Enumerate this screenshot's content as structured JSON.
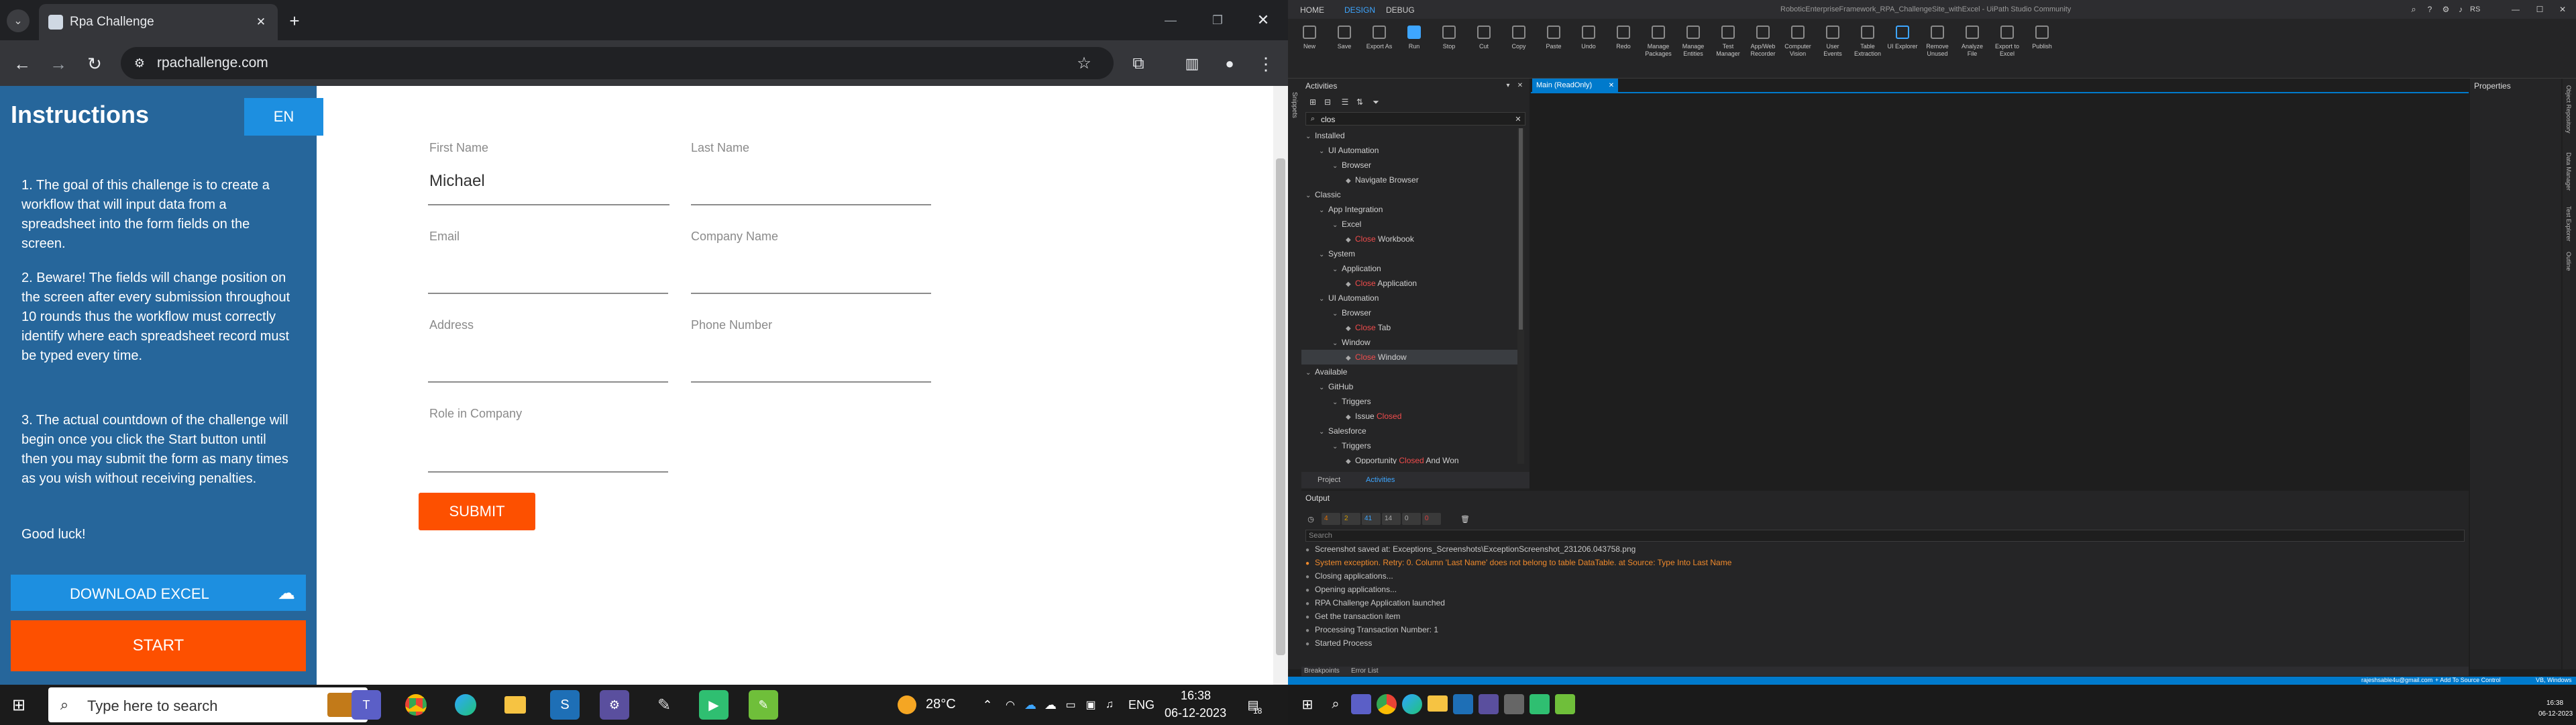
{
  "browser": {
    "tab_title": "Rpa Challenge",
    "url": "rpachallenge.com",
    "window_controls": {
      "minimize": "—",
      "restore": "❐",
      "close": "✕"
    }
  },
  "challenge": {
    "heading": "Instructions",
    "language_button": "EN",
    "paragraphs": [
      "1. The goal of this challenge is to create a workflow that will input data from a spreadsheet into the form fields on the screen.",
      "2. Beware! The fields will change position on the screen after every submission throughout 10 rounds thus the workflow must correctly identify where each spreadsheet record must be typed every time.",
      "3. The actual countdown of the challenge will begin once you click the Start button until then you may submit the form as many times as you wish without receiving penalties.",
      "Good luck!"
    ],
    "download_button": "DOWNLOAD EXCEL",
    "start_button": "START",
    "fields": {
      "first_name": {
        "label": "First Name",
        "value": "Michael"
      },
      "last_name": {
        "label": "Last Name",
        "value": ""
      },
      "email": {
        "label": "Email",
        "value": ""
      },
      "company_name": {
        "label": "Company Name",
        "value": ""
      },
      "address": {
        "label": "Address",
        "value": ""
      },
      "phone_number": {
        "label": "Phone Number",
        "value": ""
      },
      "role": {
        "label": "Role in Company",
        "value": ""
      }
    },
    "submit_button": "SUBMIT"
  },
  "uipath": {
    "title": "RoboticEnterpriseFramework_RPA_ChallengeSite_withExcel - UiPath Studio Community",
    "menu_tabs": [
      "HOME",
      "DESIGN",
      "DEBUG"
    ],
    "active_tab": "DESIGN",
    "user_initials": "RS",
    "ribbon": [
      "New",
      "Save",
      "Export As",
      "Run",
      "Stop",
      "Cut",
      "Copy",
      "Paste",
      "Undo",
      "Redo",
      "Manage Packages",
      "Manage Entities",
      "Test Manager",
      "App/Web Recorder",
      "Computer Vision",
      "User Events",
      "Table Extraction",
      "UI Explorer",
      "Remove Unused",
      "Analyze File",
      "Export to Excel",
      "Publish"
    ],
    "activities_title": "Activities",
    "search_value": "clos",
    "tree": [
      {
        "text": "Installed",
        "level": 0
      },
      {
        "text": "UI Automation",
        "level": 1
      },
      {
        "text": "Browser",
        "level": 2
      },
      {
        "text": "Navigate Browser",
        "level": 3
      },
      {
        "text": "Classic",
        "level": 0
      },
      {
        "text": "App Integration",
        "level": 1
      },
      {
        "text": "Excel",
        "level": 2
      },
      {
        "hl": "Close",
        "text": " Workbook",
        "level": 3
      },
      {
        "text": "System",
        "level": 1
      },
      {
        "text": "Application",
        "level": 2
      },
      {
        "hl": "Close",
        "text": " Application",
        "level": 3
      },
      {
        "text": "UI Automation",
        "level": 1
      },
      {
        "text": "Browser",
        "level": 2
      },
      {
        "hl": "Close",
        "text": " Tab",
        "level": 3
      },
      {
        "text": "Window",
        "level": 2
      },
      {
        "hl": "Close",
        "text": " Window",
        "level": 3,
        "selected": true
      },
      {
        "text": "Available",
        "level": 0
      },
      {
        "text": "GitHub",
        "level": 1
      },
      {
        "text": "Triggers",
        "level": 2
      },
      {
        "text": "Issue ",
        "hl2": "Closed",
        "level": 3
      },
      {
        "text": "Salesforce",
        "level": 1
      },
      {
        "text": "Triggers",
        "level": 2
      },
      {
        "text": "Opportunity ",
        "hl2": "Closed",
        "tail": " And Won",
        "level": 3
      }
    ],
    "panel_tabs": {
      "project": "Project",
      "activities": "Activities"
    },
    "doc_tab": "Main (ReadOnly)",
    "properties_title": "Properties",
    "output_title": "Output",
    "output_counts": [
      "4",
      "2",
      "41",
      "14",
      "0",
      "0"
    ],
    "output_search": "Search",
    "output_lines": [
      {
        "text": "Screenshot saved at: Exceptions_Screenshots\\ExceptionScreenshot_231206.043758.png",
        "kind": "info"
      },
      {
        "text": "System exception. Retry: 0. Column 'Last Name' does not belong to table DataTable. at Source: Type Into Last Name",
        "kind": "error"
      },
      {
        "text": "Closing applications...",
        "kind": "info"
      },
      {
        "text": "Opening applications...",
        "kind": "info"
      },
      {
        "text": "RPA Challenge Application launched",
        "kind": "info"
      },
      {
        "text": "Get the transaction item",
        "kind": "info"
      },
      {
        "text": "Processing Transaction Number: 1",
        "kind": "info"
      },
      {
        "text": "Started Process",
        "kind": "info"
      }
    ],
    "bottom_tabs": [
      "Breakpoints",
      "Error List"
    ],
    "status": {
      "user": "rajeshsable4u@gmail.com",
      "add_source": "+ Add To Source Control",
      "vb": "VB, Windows"
    },
    "side_tabs": [
      "Object Repository",
      "Data Manager",
      "Test Explorer",
      "Outline"
    ],
    "left_side_tab": "Snippets"
  },
  "taskbar": {
    "search_placeholder": "Type here to search",
    "temperature": "28°C",
    "language": "ENG",
    "time": "16:38",
    "date": "06-12-2023",
    "notifications": "18"
  },
  "taskbar2": {
    "time": "16:38",
    "date": "06-12-2023"
  },
  "colors": {
    "chrome_bg": "#202124",
    "left_panel": "#26669b",
    "accent_orange": "#fd5000",
    "ui_accent": "#007acc"
  }
}
